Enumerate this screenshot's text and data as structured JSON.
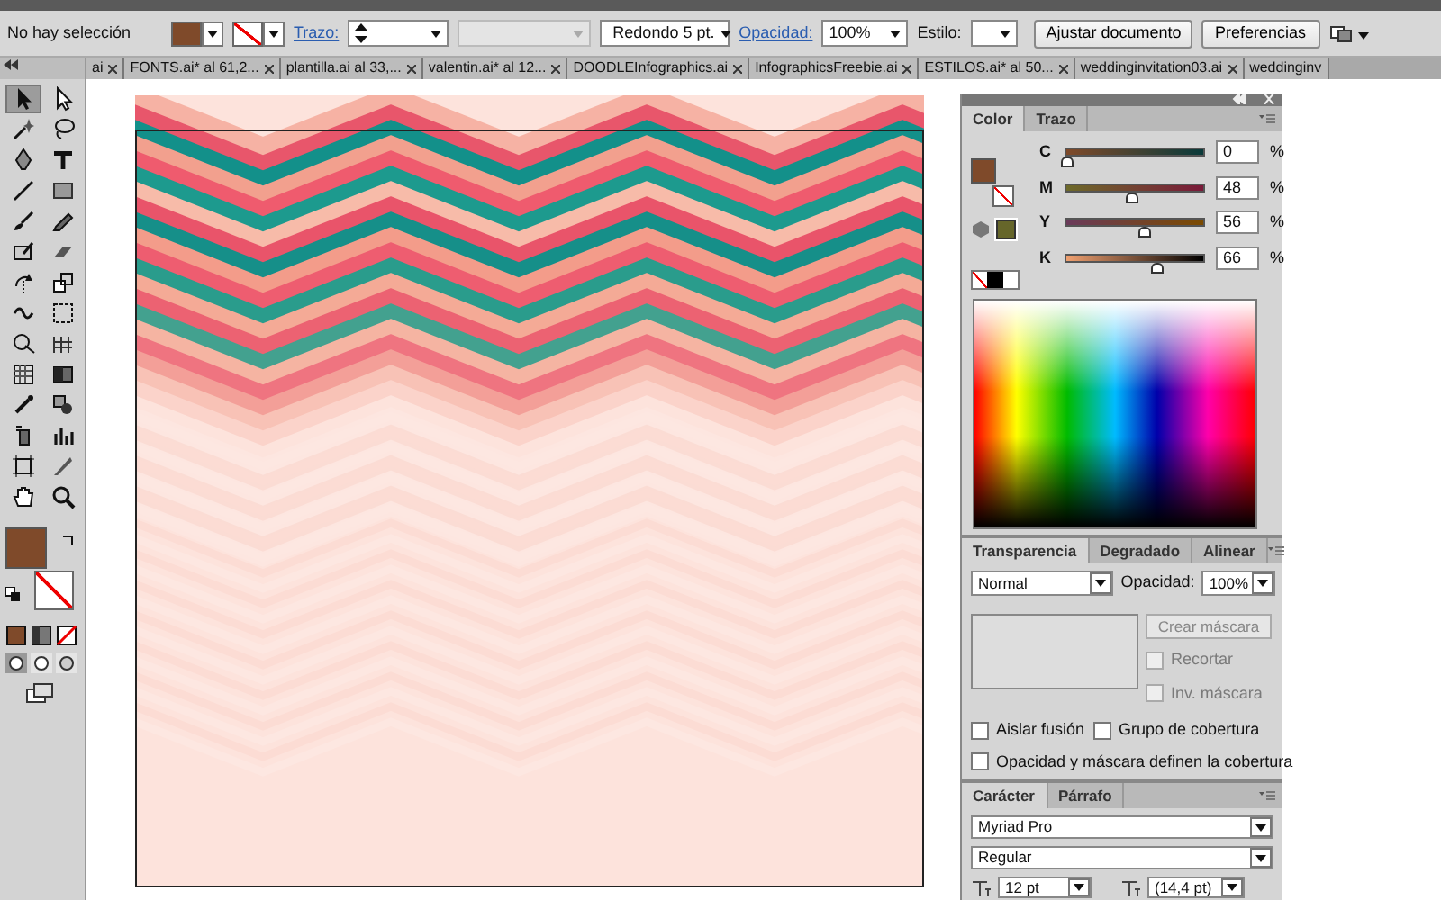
{
  "control_bar": {
    "selection": "No hay selección",
    "fill": {
      "color": "#7f4a2a"
    },
    "stroke": {
      "kind": "none"
    },
    "stroke_label": "Trazo:",
    "profile": {
      "disabled": true
    },
    "brush": "Redondo 5 pt.",
    "opacity_label": "Opacidad:",
    "opacity": "100%",
    "style_label": "Estilo:",
    "buttons": [
      "Ajustar documento",
      "Preferencias"
    ]
  },
  "document_tabs": [
    {
      "label": "ai",
      "selected": false
    },
    {
      "label": "FONTS.ai* al 61,2...",
      "selected": false
    },
    {
      "label": "plantilla.ai al 33,...",
      "selected": false
    },
    {
      "label": "valentin.ai* al 12...",
      "selected": false
    },
    {
      "label": "DOODLEInfographics.ai",
      "selected": false
    },
    {
      "label": "InfographicsFreebie.ai",
      "selected": false
    },
    {
      "label": "ESTILOS.ai* al 50...",
      "selected": false
    },
    {
      "label": "weddinginvitation03.ai",
      "selected": false
    },
    {
      "label": "weddinginv",
      "selected": false
    }
  ],
  "tools": [
    {
      "kind": "selection",
      "selected": true
    },
    {
      "kind": "direct",
      "selected": false
    },
    {
      "kind": "wand",
      "selected": false
    },
    {
      "kind": "lasso",
      "selected": false
    },
    {
      "kind": "pen",
      "selected": false
    },
    {
      "kind": "type",
      "selected": false
    },
    {
      "kind": "line",
      "selected": false
    },
    {
      "kind": "rectangle",
      "selected": false
    },
    {
      "kind": "brush",
      "selected": false
    },
    {
      "kind": "pencil",
      "selected": false
    },
    {
      "kind": "blob",
      "selected": false
    },
    {
      "kind": "eraser",
      "selected": false
    },
    {
      "kind": "rotate",
      "selected": false
    },
    {
      "kind": "scale",
      "selected": false
    },
    {
      "kind": "warp",
      "selected": false
    },
    {
      "kind": "transform",
      "selected": false
    },
    {
      "kind": "builder",
      "selected": false
    },
    {
      "kind": "perspective",
      "selected": false
    },
    {
      "kind": "mesh",
      "selected": false
    },
    {
      "kind": "gradient",
      "selected": false
    },
    {
      "kind": "eyedropper",
      "selected": false
    },
    {
      "kind": "blend",
      "selected": false
    },
    {
      "kind": "spray",
      "selected": false
    },
    {
      "kind": "graph",
      "selected": false
    },
    {
      "kind": "artboard",
      "selected": false
    },
    {
      "kind": "slice",
      "selected": false
    },
    {
      "kind": "hand",
      "selected": false
    },
    {
      "kind": "zoom",
      "selected": false
    }
  ],
  "fill_stroke": {
    "fill": {
      "color": "#7f4a2a"
    },
    "stroke": {
      "kind": "none"
    }
  },
  "color_panel": {
    "tabs": [
      {
        "label": "Color",
        "selected": true
      },
      {
        "label": "Trazo",
        "selected": false
      }
    ],
    "gamut_swatch": {
      "color": "#66662a"
    },
    "sliders": [
      {
        "label": "C",
        "level": 0,
        "value": "0",
        "unit": "%"
      },
      {
        "label": "M",
        "level": 0.48,
        "value": "48",
        "unit": "%"
      },
      {
        "label": "Y",
        "level": 0.56,
        "value": "56",
        "unit": "%"
      },
      {
        "label": "K",
        "level": 0.66,
        "value": "66",
        "unit": "%"
      }
    ]
  },
  "transparency_panel": {
    "tabs": [
      {
        "label": "Transparencia",
        "selected": true
      },
      {
        "label": "Degradado",
        "selected": false
      },
      {
        "label": "Alinear",
        "selected": false
      }
    ],
    "blend_mode": "Normal",
    "opacity_label": "Opacidad:",
    "opacity": "100%",
    "mask_button": {
      "label": "Crear máscara",
      "disabled": true
    },
    "mask_options": [
      {
        "label": "Recortar",
        "checked": false,
        "disabled": true
      },
      {
        "label": "Inv. máscara",
        "checked": false,
        "disabled": true
      }
    ],
    "options": [
      {
        "label": "Aislar fusión",
        "checked": false
      },
      {
        "label": "Grupo de cobertura",
        "checked": false
      },
      {
        "label": "Opacidad y máscara definen la cobertura",
        "checked": false
      }
    ]
  },
  "character_panel": {
    "tabs": [
      {
        "label": "Carácter",
        "selected": true
      },
      {
        "label": "Párrafo",
        "selected": false
      }
    ],
    "font": "Myriad Pro",
    "style": "Regular",
    "size": "12 pt",
    "leading": "(14,4 pt)"
  }
}
